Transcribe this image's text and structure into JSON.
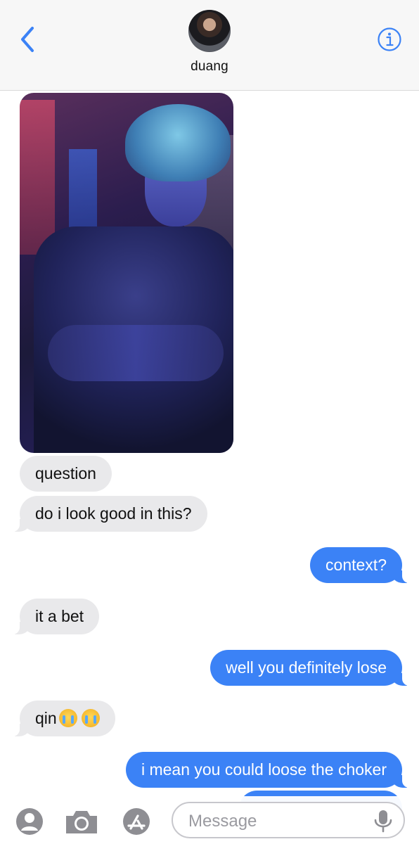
{
  "header": {
    "contact_name": "duang"
  },
  "conversation": {
    "messages": [
      {
        "from": "them",
        "type": "photo"
      },
      {
        "from": "them",
        "text": "question"
      },
      {
        "from": "them",
        "text": "do i look good in this?"
      },
      {
        "from": "me",
        "text": "context?"
      },
      {
        "from": "them",
        "text": "it a bet"
      },
      {
        "from": "me",
        "text": "well you definitely lose"
      },
      {
        "from": "them",
        "text": "qin",
        "emojis": [
          "loudly-crying-face",
          "loudly-crying-face"
        ]
      },
      {
        "from": "me",
        "text": "i mean you could loose the choker"
      }
    ]
  },
  "input_bar": {
    "placeholder": "Message",
    "icons": [
      "memoji-icon",
      "camera-icon",
      "app-store-icon",
      "mic-icon"
    ]
  },
  "colors": {
    "accent": "#3b82f6",
    "incoming_bubble": "#e9e9eb",
    "outgoing_text": "#ffffff"
  }
}
